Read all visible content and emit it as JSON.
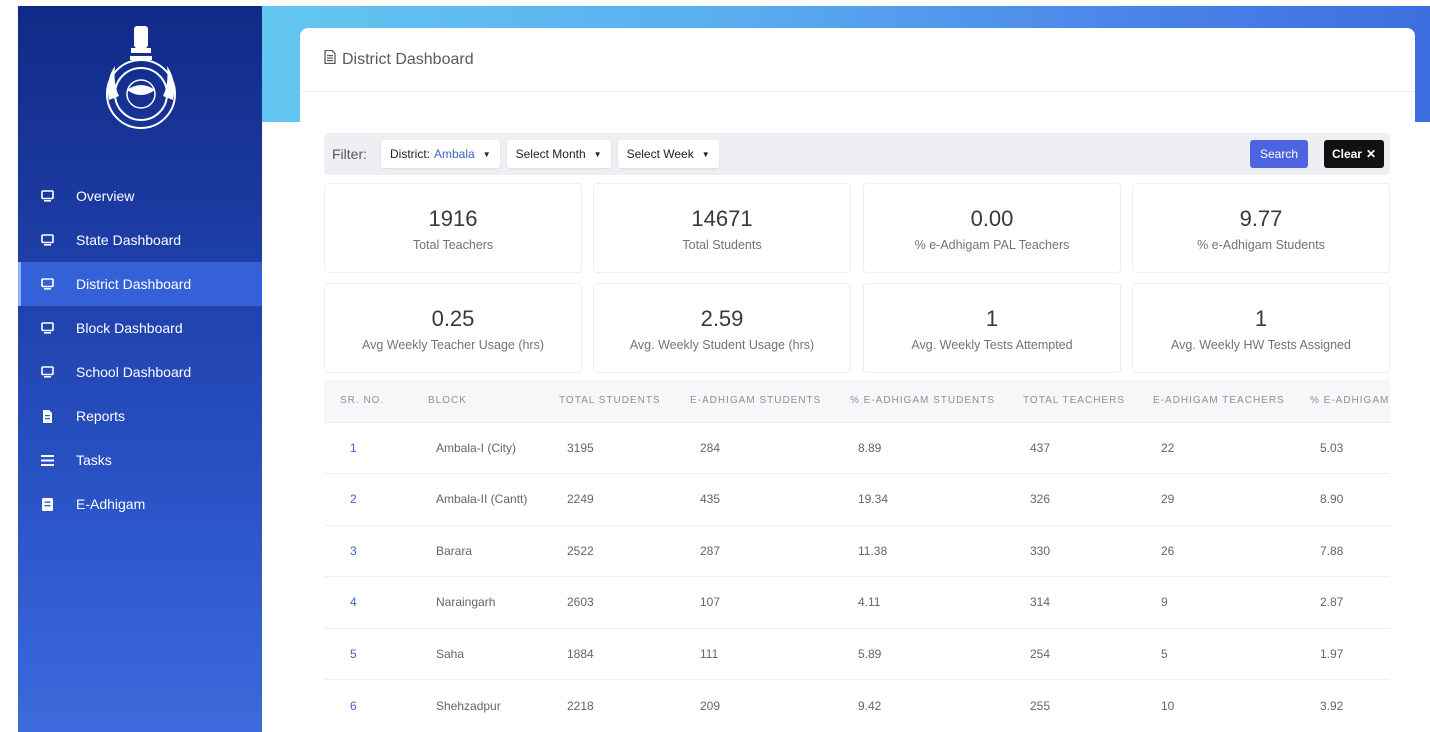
{
  "sidebar": {
    "items": [
      {
        "label": "Overview",
        "icon": "monitor-icon"
      },
      {
        "label": "State Dashboard",
        "icon": "monitor-icon"
      },
      {
        "label": "District Dashboard",
        "icon": "monitor-icon",
        "active": true
      },
      {
        "label": "Block Dashboard",
        "icon": "monitor-icon"
      },
      {
        "label": "School Dashboard",
        "icon": "monitor-icon"
      },
      {
        "label": "Reports",
        "icon": "document-icon"
      },
      {
        "label": "Tasks",
        "icon": "list-icon"
      },
      {
        "label": "E-Adhigam",
        "icon": "book-icon"
      }
    ]
  },
  "page": {
    "title": "District Dashboard"
  },
  "filter": {
    "label": "Filter:",
    "district_label": "District:",
    "district_value": "Ambala",
    "month": "Select Month",
    "week": "Select Week",
    "search": "Search",
    "clear": "Clear"
  },
  "stats": [
    {
      "value": "1916",
      "label": "Total Teachers"
    },
    {
      "value": "14671",
      "label": "Total Students"
    },
    {
      "value": "0.00",
      "label": "% e-Adhigam PAL Teachers"
    },
    {
      "value": "9.77",
      "label": "% e-Adhigam Students"
    },
    {
      "value": "0.25",
      "label": "Avg Weekly Teacher Usage (hrs)"
    },
    {
      "value": "2.59",
      "label": "Avg. Weekly Student Usage (hrs)"
    },
    {
      "value": "1",
      "label": "Avg. Weekly Tests Attempted"
    },
    {
      "value": "1",
      "label": "Avg. Weekly HW Tests Assigned"
    }
  ],
  "table": {
    "headers": [
      "SR. NO.",
      "BLOCK",
      "TOTAL STUDENTS",
      "E-ADHIGAM STUDENTS",
      "% E-ADHIGAM STUDENTS",
      "TOTAL TEACHERS",
      "E-ADHIGAM TEACHERS",
      "% E-ADHIGAM"
    ],
    "rows": [
      [
        "1",
        "Ambala-I (City)",
        "3195",
        "284",
        "8.89",
        "437",
        "22",
        "5.03"
      ],
      [
        "2",
        "Ambala-II (Cantt)",
        "2249",
        "435",
        "19.34",
        "326",
        "29",
        "8.90"
      ],
      [
        "3",
        "Barara",
        "2522",
        "287",
        "11.38",
        "330",
        "26",
        "7.88"
      ],
      [
        "4",
        "Naraingarh",
        "2603",
        "107",
        "4.11",
        "314",
        "9",
        "2.87"
      ],
      [
        "5",
        "Saha",
        "1884",
        "111",
        "5.89",
        "254",
        "5",
        "1.97"
      ],
      [
        "6",
        "Shehzadpur",
        "2218",
        "209",
        "9.42",
        "255",
        "10",
        "3.92"
      ]
    ]
  },
  "colors": {
    "sidebar_top": "#102a86",
    "sidebar_bottom": "#3c6bdc",
    "accent": "#3e62c9",
    "search_button": "#4d64e0",
    "clear_button": "#111111"
  }
}
